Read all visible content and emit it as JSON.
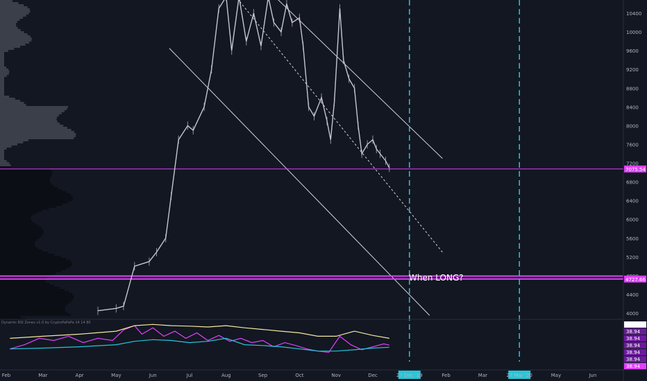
{
  "header": {
    "title": "",
    "indicator_title": "Dynamic RSI Zones v1.0 by CryptoPaPaPa 14 14 80"
  },
  "annotation": {
    "text": "When LONG?"
  },
  "colors": {
    "background": "#131722",
    "price_line": "#c4c7cf",
    "hline": "#e040fb",
    "dash_vline": "#26c6da",
    "channel": "#d1d4dc",
    "rsi_main": "#e040fb",
    "rsi_cyan": "#26c6da",
    "rsi_yellow": "#f5e99f"
  },
  "chart_data": [
    {
      "type": "line",
      "title": "",
      "x_axis": {
        "labels": [
          "Feb",
          "Mar",
          "Apr",
          "May",
          "Jun",
          "Jul",
          "Aug",
          "Sep",
          "Oct",
          "Nov",
          "Dec",
          "27 Dec '19",
          "Feb",
          "Mar",
          "27 Mar '20",
          "May",
          "Jun"
        ],
        "highlight_labels": [
          "27 Dec '19",
          "27 Mar '20"
        ]
      },
      "y_axis": {
        "ticks": [
          10400,
          10000,
          9600,
          9200,
          8800,
          8400,
          8000,
          7600,
          7200,
          6800,
          6400,
          6000,
          5600,
          5200,
          4800,
          4400,
          4000
        ],
        "range": [
          3950,
          10750
        ]
      },
      "price_tags": [
        {
          "label": "7075.54",
          "value": 7075.54
        },
        {
          "label": "4727.66",
          "value": 4727.66
        }
      ],
      "horizontal_lines": [
        7075.54,
        4727.66,
        4790
      ],
      "vertical_dashed_lines": [
        "27 Dec '19",
        "27 Mar '20"
      ],
      "series": [
        {
          "x": [
            2.5,
            3.0,
            3.2,
            3.5,
            3.9,
            4.1,
            4.35,
            4.5,
            4.7,
            4.95,
            5.1,
            5.4,
            5.6,
            5.8,
            6.0,
            6.15,
            6.35,
            6.55,
            6.75,
            6.95,
            7.15,
            7.3,
            7.5,
            7.65,
            7.8,
            8.0,
            8.1,
            8.25,
            8.4,
            8.6,
            8.75,
            8.85,
            8.95,
            9.1,
            9.2,
            9.35,
            9.5,
            9.6,
            9.7,
            9.85,
            10.0,
            10.1,
            10.2,
            10.35,
            10.45
          ],
          "values": [
            4050,
            4100,
            4150,
            5000,
            5100,
            5300,
            5600,
            6500,
            7700,
            8000,
            7900,
            8400,
            9200,
            10500,
            11200,
            9600,
            10800,
            9800,
            10400,
            9700,
            10900,
            10200,
            10000,
            10600,
            10200,
            10300,
            9700,
            8400,
            8200,
            8600,
            8100,
            7700,
            8500,
            10500,
            9400,
            9000,
            8800,
            8000,
            7400,
            7600,
            7700,
            7500,
            7400,
            7250,
            7100
          ]
        }
      ],
      "channels": [
        {
          "name": "upper",
          "from": [
            7.0,
            11000
          ],
          "to": [
            11.9,
            7300
          ]
        },
        {
          "name": "middle",
          "from": [
            5.8,
            11200
          ],
          "to": [
            11.9,
            5300
          ]
        },
        {
          "name": "lower",
          "from": [
            4.45,
            9650
          ],
          "to": [
            11.55,
            3950
          ]
        }
      ]
    },
    {
      "type": "line",
      "title": "Dynamic RSI Zones v1.0 by CryptoPaPaPa 14 14 80",
      "y_axis": {
        "tag_labels": [
          "38.94",
          "38.94",
          "38.94",
          "38.94",
          "38.94",
          "38.94",
          "38.94"
        ]
      },
      "series": [
        {
          "name": "RSI",
          "color": "#e040fb",
          "x": [
            0.1,
            0.5,
            0.9,
            1.3,
            1.7,
            2.1,
            2.5,
            2.9,
            3.2,
            3.5,
            3.7,
            4.0,
            4.3,
            4.6,
            4.9,
            5.2,
            5.5,
            5.8,
            6.1,
            6.4,
            6.7,
            7.0,
            7.3,
            7.6,
            7.9,
            8.2,
            8.5,
            8.8,
            9.1,
            9.4,
            9.7,
            10.0,
            10.3,
            10.45
          ],
          "values": [
            30,
            40,
            55,
            50,
            60,
            45,
            55,
            50,
            75,
            85,
            65,
            80,
            60,
            72,
            55,
            68,
            50,
            62,
            48,
            55,
            45,
            50,
            35,
            45,
            38,
            30,
            25,
            22,
            60,
            40,
            28,
            35,
            42,
            38.94
          ]
        },
        {
          "name": "Upper band",
          "color": "#f5e99f",
          "x": [
            0.1,
            1.0,
            2.0,
            3.0,
            3.5,
            4.0,
            4.5,
            5.0,
            5.5,
            6.0,
            6.5,
            7.0,
            7.5,
            8.0,
            8.5,
            9.0,
            9.5,
            10.0,
            10.45
          ],
          "values": [
            55,
            60,
            65,
            72,
            85,
            88,
            85,
            84,
            82,
            85,
            80,
            76,
            72,
            68,
            60,
            60,
            72,
            62,
            55
          ]
        },
        {
          "name": "Lower band",
          "color": "#26c6da",
          "x": [
            0.1,
            1.0,
            2.0,
            3.0,
            3.5,
            4.0,
            4.5,
            5.0,
            5.5,
            6.0,
            6.5,
            7.0,
            7.5,
            8.0,
            8.5,
            9.0,
            9.5,
            10.0,
            10.45
          ],
          "values": [
            30,
            32,
            35,
            40,
            48,
            52,
            50,
            45,
            48,
            55,
            40,
            38,
            35,
            30,
            25,
            25,
            28,
            32,
            34
          ]
        }
      ]
    }
  ]
}
